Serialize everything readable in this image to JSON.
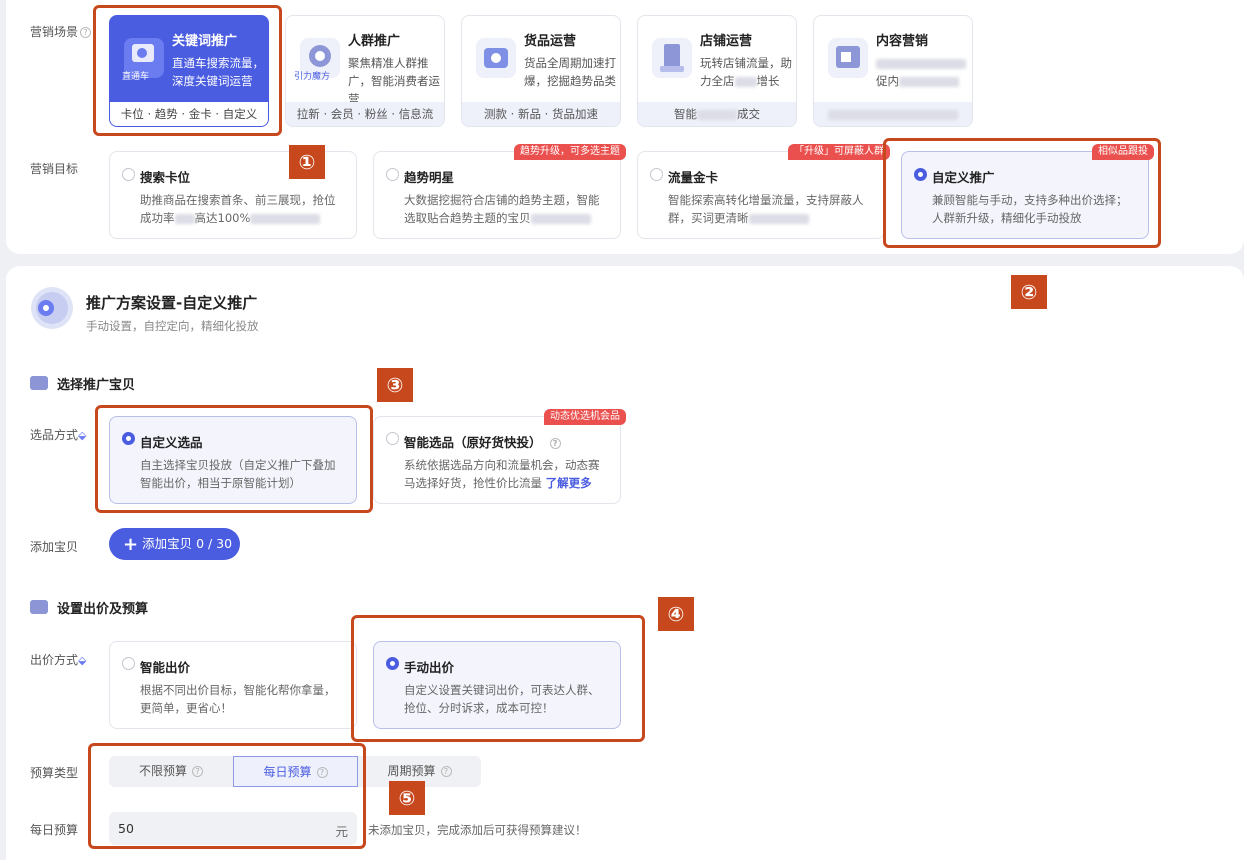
{
  "scene": {
    "label": "营销场景",
    "cards": [
      {
        "title": "关键词推广",
        "desc": "直通车搜索流量，深度关键词运营",
        "foot": "卡位 · 趋势 · 金卡 · 自定义",
        "icon_label": "直通车"
      },
      {
        "title": "人群推广",
        "desc": "聚焦精准人群推广，智能消费者运营",
        "foot": "拉新 · 会员 · 粉丝 · 信息流",
        "icon_label": "引力魔方"
      },
      {
        "title": "货品运营",
        "desc": "货品全周期加速打爆，挖掘趋势品类",
        "foot": "测款 · 新品 · 货品加速"
      },
      {
        "title": "店铺运营",
        "desc_a": "玩转店铺流量，助",
        "desc_b": "力全店",
        "desc_c": "增长",
        "foot_a": "智能",
        "foot_b": "成交"
      },
      {
        "title": "内容营销",
        "desc_a": "",
        "desc_b": "促内"
      }
    ]
  },
  "goal": {
    "label": "营销目标",
    "cards": [
      {
        "title": "搜索卡位",
        "desc_a": "助推商品在搜索首条、前三展现，抢位",
        "desc_b": "成功率",
        "desc_c": "高达100%"
      },
      {
        "title": "趋势明星",
        "desc_a": "大数据挖掘符合店铺的趋势主题，智能",
        "desc_b": "选取贴合趋势主题的宝贝",
        "tag": "趋势升级，可多选主题"
      },
      {
        "title": "流量金卡",
        "desc_a": "智能探索高转化增量流量，支持屏蔽人",
        "desc_b": "群，买词更清晰",
        "tag": "「升级」可屏蔽人群"
      },
      {
        "title": "自定义推广",
        "desc_a": "兼顾智能与手动，支持多种出价选择；",
        "desc_b": "人群新升级，精细化手动投放",
        "tag": "相似品跟投"
      }
    ]
  },
  "plan": {
    "title": "推广方案设置-自定义推广",
    "subtitle": "手动设置，自控定向，精细化投放"
  },
  "select_section": {
    "title": "选择推广宝贝",
    "method_label": "选品方式",
    "options": [
      {
        "title": "自定义选品",
        "desc_a": "自主选择宝贝投放（自定义推广下叠加",
        "desc_b": "智能出价，相当于原智能计划）"
      },
      {
        "title": "智能选品（原好货快投）",
        "desc_a": "系统依据选品方向和流量机会，动态赛",
        "desc_b": "马选择好货，抢性价比流量",
        "link": "了解更多",
        "tag": "动态优选机会品"
      }
    ],
    "add_label": "添加宝贝",
    "add_button": "添加宝贝 0 / 30"
  },
  "bid_section": {
    "title": "设置出价及预算",
    "method_label": "出价方式",
    "options": [
      {
        "title": "智能出价",
        "desc_a": "根据不同出价目标，智能化帮你拿量，",
        "desc_b": "更简单，更省心！"
      },
      {
        "title": "手动出价",
        "desc_a": "自定义设置关键词出价，可表达人群、",
        "desc_b": "抢位、分时诉求，成本可控！"
      }
    ],
    "budget_type_label": "预算类型",
    "budget_types": [
      "不限预算",
      "每日预算",
      "周期预算"
    ],
    "daily_label": "每日预算",
    "daily_value": "50",
    "daily_unit": "元",
    "hint": "未添加宝贝，完成添加后可获得预算建议！"
  },
  "markers": [
    "①",
    "②",
    "③",
    "④",
    "⑤"
  ],
  "colors": {
    "accent": "#4a5ce0",
    "annotation": "#c8481e",
    "tag": "#e9504e"
  }
}
